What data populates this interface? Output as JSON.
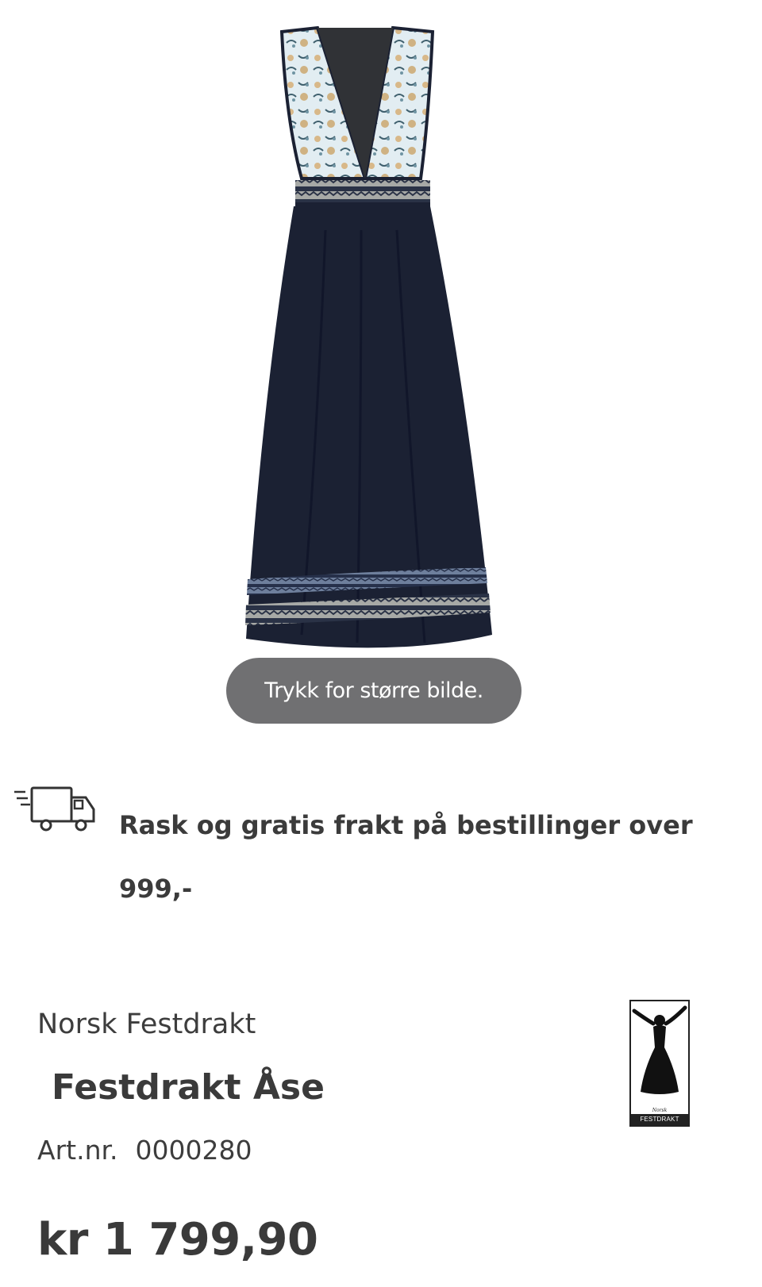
{
  "product_image": {
    "zoom_hint": "Trykk for større bilde."
  },
  "shipping": {
    "icon": "truck-icon",
    "text": "Rask og gratis frakt på bestillinger over 999,-"
  },
  "product": {
    "brand": "Norsk Festdrakt",
    "title": "Festdrakt Åse",
    "article_label": "Art.nr.",
    "article_number": "0000280",
    "price": "kr 1 799,90"
  },
  "brand_logo": {
    "script_text": "Norsk",
    "caption": "FESTDRAKT"
  },
  "colors": {
    "dress_navy": "#1b2133",
    "bodice_light": "#e3eef3",
    "hint_bg": "#646466",
    "text": "#3a3a3a"
  }
}
